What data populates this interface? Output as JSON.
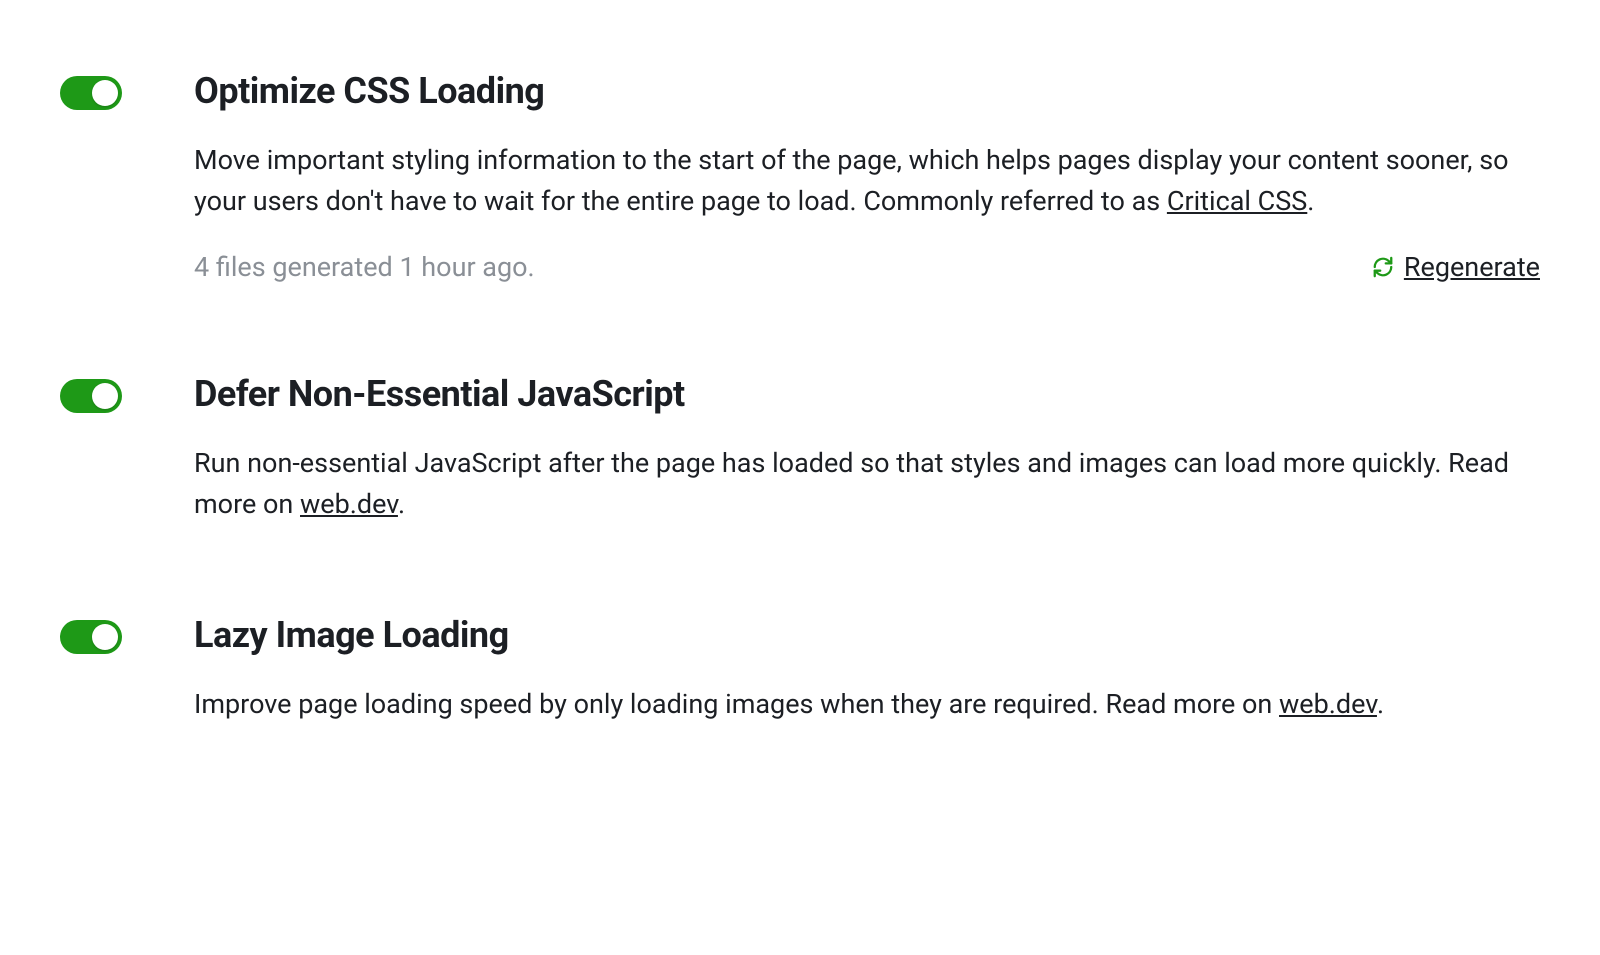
{
  "settings": [
    {
      "title": "Optimize CSS Loading",
      "desc_prefix": "Move important styling information to the start of the page, which helps pages display your content sooner, so your users don't have to wait for the entire page to load. Commonly referred to as ",
      "link_text": "Critical CSS",
      "desc_suffix": ".",
      "status": "4 files generated 1 hour ago.",
      "regenerate_label": "Regenerate",
      "enabled": true,
      "has_status": true
    },
    {
      "title": "Defer Non-Essential JavaScript",
      "desc_prefix": "Run non-essential JavaScript after the page has loaded so that styles and images can load more quickly. Read more on ",
      "link_text": "web.dev",
      "desc_suffix": ".",
      "enabled": true,
      "has_status": false
    },
    {
      "title": "Lazy Image Loading",
      "desc_prefix": "Improve page loading speed by only loading images when they are required. Read more on ",
      "link_text": "web.dev",
      "desc_suffix": ".",
      "enabled": true,
      "has_status": false
    }
  ],
  "colors": {
    "toggle_on": "#1e9917",
    "text_primary": "#1c1f24",
    "text_muted": "#8a8f96"
  }
}
